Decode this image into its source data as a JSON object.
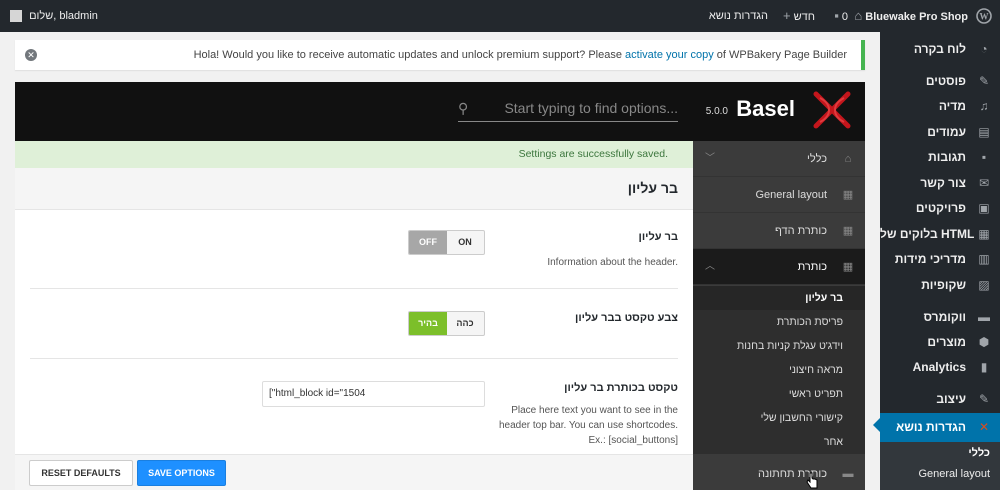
{
  "admin_bar": {
    "site_name": "Bluewake Pro Shop",
    "comments_count": "0",
    "new_label": "חדש",
    "theme_settings_label": "הגדרות נושא",
    "greeting": "שלום, bladmin"
  },
  "sidebar": {
    "items": [
      {
        "label": "לוח בקרה",
        "icon": "dashboard-icon"
      },
      {
        "label": "פוסטים",
        "icon": "pin-icon"
      },
      {
        "label": "מדיה",
        "icon": "media-icon"
      },
      {
        "label": "עמודים",
        "icon": "page-icon"
      },
      {
        "label": "תגובות",
        "icon": "comment-icon"
      },
      {
        "label": "צור קשר",
        "icon": "mail-icon"
      },
      {
        "label": "פרויקטים",
        "icon": "portfolio-icon"
      },
      {
        "label": "בלוקים של HTML",
        "icon": "grid-icon"
      },
      {
        "label": "מדריכי מידות",
        "icon": "table-icon"
      },
      {
        "label": "שקופיות",
        "icon": "image-icon"
      },
      {
        "label": "ווקומרס",
        "icon": "woo-icon"
      },
      {
        "label": "מוצרים",
        "icon": "box-icon"
      },
      {
        "label": "Analytics",
        "icon": "bar-chart-icon"
      },
      {
        "label": "עיצוב",
        "icon": "brush-icon"
      },
      {
        "label": "הגדרות נושא",
        "icon": "basel-logo-icon"
      }
    ],
    "submenu": [
      {
        "label": "כללי"
      },
      {
        "label": "General layout"
      }
    ]
  },
  "notice": {
    "text_before": "Hola! Would you like to receive automatic updates and unlock premium support? Please",
    "link": "activate your copy",
    "text_after": "of WPBakery Page Builder"
  },
  "options_header": {
    "logo": "Basel",
    "version": "5.0.0",
    "search_placeholder": "Start typing to find options..."
  },
  "options_nav": {
    "items": [
      {
        "label": "כללי",
        "icon": "home-icon"
      },
      {
        "label": "General layout",
        "icon": "layout-icon"
      },
      {
        "label": "כותרת הדף",
        "icon": "grid-icon"
      },
      {
        "label": "כותרת",
        "icon": "header-icon"
      }
    ],
    "subitems": [
      {
        "label": "בר עליון"
      },
      {
        "label": "פריסת הכותרת"
      },
      {
        "label": "וידג'ט עגלת קניות בחנות"
      },
      {
        "label": "מראה חיצוני"
      },
      {
        "label": "תפריט ראשי"
      },
      {
        "label": "קישורי החשבון שלי"
      },
      {
        "label": "אחר"
      }
    ],
    "footer_item": {
      "label": "כותרת תחתונה",
      "icon": "footer-icon"
    }
  },
  "content": {
    "saved_notice": "Settings are successfully saved.",
    "section_title": "בר עליון",
    "options": [
      {
        "title": "בר עליון",
        "description": "Information about the header.",
        "switch": {
          "left": "OFF",
          "right": "ON",
          "selected": "OFF"
        }
      },
      {
        "title": "צבע טקסט בבר עליון",
        "switch": {
          "left": "בהיר",
          "right": "כהה",
          "selected": "בהיר"
        }
      },
      {
        "title": "טקסט בכותרת בר עליון",
        "value": "[\"html_block id=\"1504",
        "description_lines": [
          "Place here text you want to see in the",
          "header top bar. You can use shortcodes.",
          "Ex.: [social_buttons]"
        ]
      }
    ]
  },
  "buttons": {
    "reset": "RESET DEFAULTS",
    "save": "SAVE OPTIONS"
  },
  "colors": {
    "admin_dark": "#23282d",
    "wp_blue": "#0073aa",
    "save_blue": "#1e90ff",
    "switch_green": "#7cbf2a",
    "saved_green_bg": "#dff0d8"
  }
}
